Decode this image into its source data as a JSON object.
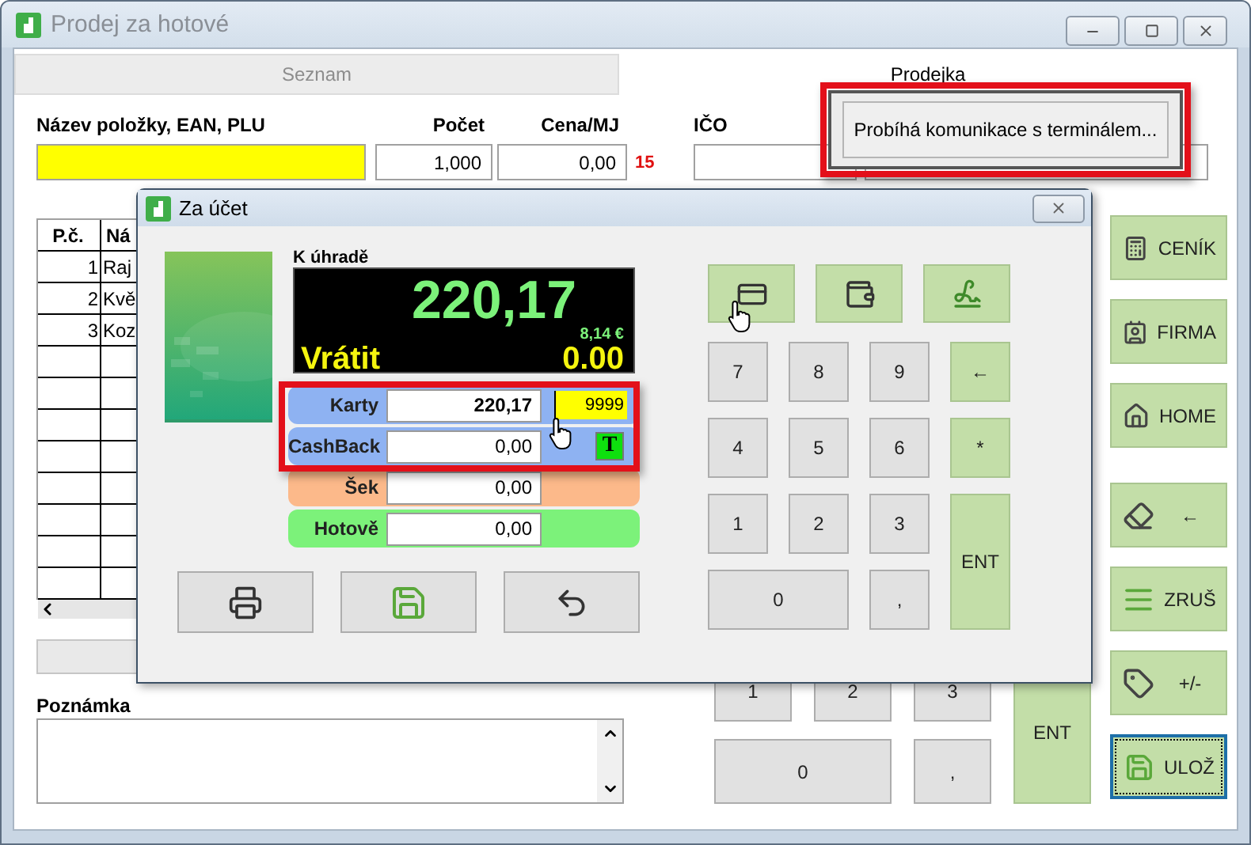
{
  "window": {
    "title": "Prodej za hotové"
  },
  "tabs": [
    {
      "label": "Seznam",
      "selected": false
    },
    {
      "label": "Prodejka",
      "selected": true
    }
  ],
  "item_entry": {
    "name_label": "Název položky, EAN, PLU",
    "count_label": "Počet",
    "price_label": "Cena/MJ",
    "ico_label": "IČO",
    "count": "1,000",
    "price": "0,00",
    "vat": "15"
  },
  "table": {
    "columns": [
      "P.č.",
      "Ná"
    ],
    "rows": [
      [
        "1",
        "Raj"
      ],
      [
        "2",
        "Kvě"
      ],
      [
        "3",
        "Koz"
      ]
    ]
  },
  "note": {
    "label": "Poznámka"
  },
  "keypad": [
    {
      "label": "1",
      "kind": "digit"
    },
    {
      "label": "2",
      "kind": "digit"
    },
    {
      "label": "3",
      "kind": "digit"
    },
    {
      "label": "ENT",
      "kind": "tall"
    },
    {
      "label": "0",
      "kind": "wide"
    },
    {
      "label": ",",
      "kind": "digit"
    }
  ],
  "side_buttons": [
    {
      "kind": "pricelist",
      "label": "CENÍK",
      "focused": false
    },
    {
      "kind": "company",
      "label": "FIRMA",
      "focused": false
    },
    {
      "kind": "home",
      "label": "HOME",
      "focused": false
    },
    {
      "kind": "erase",
      "label": "←",
      "focused": false
    },
    {
      "kind": "cancel",
      "label": "ZRUŠ",
      "focused": false
    },
    {
      "kind": "sign",
      "label": "+/-",
      "focused": false
    },
    {
      "kind": "save",
      "label": "ULOŽ",
      "focused": true
    }
  ],
  "payment_dialog": {
    "title": "Za účet",
    "due_label": "K úhradě",
    "due": "220,17",
    "due_eur": "8,14 €",
    "change_label": "Vrátit",
    "change": "0.00",
    "payments": [
      {
        "kind": "card",
        "label": "Karty",
        "value": "220,17",
        "terminal": "9999",
        "color": "#8eb2f2"
      },
      {
        "kind": "cashback",
        "label": "CashBack",
        "value": "0,00",
        "badge": "T",
        "color": "#8eb2f2"
      },
      {
        "kind": "cheque",
        "label": "Šek",
        "value": "0,00",
        "color": "#fcb98a"
      },
      {
        "kind": "cash",
        "label": "Hotově",
        "value": "0,00",
        "color": "#7cf27a"
      }
    ],
    "methods": [
      {
        "kind": "card"
      },
      {
        "kind": "wallet"
      },
      {
        "kind": "cheque"
      }
    ],
    "actions": [
      {
        "kind": "print"
      },
      {
        "kind": "save"
      },
      {
        "kind": "undo"
      }
    ],
    "keypad": [
      {
        "label": "7",
        "kind": "digit"
      },
      {
        "label": "8",
        "kind": "digit"
      },
      {
        "label": "9",
        "kind": "digit"
      },
      {
        "label": "←",
        "kind": "action"
      },
      {
        "label": "4",
        "kind": "digit"
      },
      {
        "label": "5",
        "kind": "digit"
      },
      {
        "label": "6",
        "kind": "digit"
      },
      {
        "label": "*",
        "kind": "action"
      },
      {
        "label": "1",
        "kind": "digit"
      },
      {
        "label": "2",
        "kind": "digit"
      },
      {
        "label": "3",
        "kind": "digit"
      },
      {
        "label": "ENT",
        "kind": "tall"
      },
      {
        "label": "0",
        "kind": "wide"
      },
      {
        "label": ",",
        "kind": "digit"
      }
    ]
  },
  "status_popup": {
    "message": "Probíhá komunikace s terminálem..."
  }
}
